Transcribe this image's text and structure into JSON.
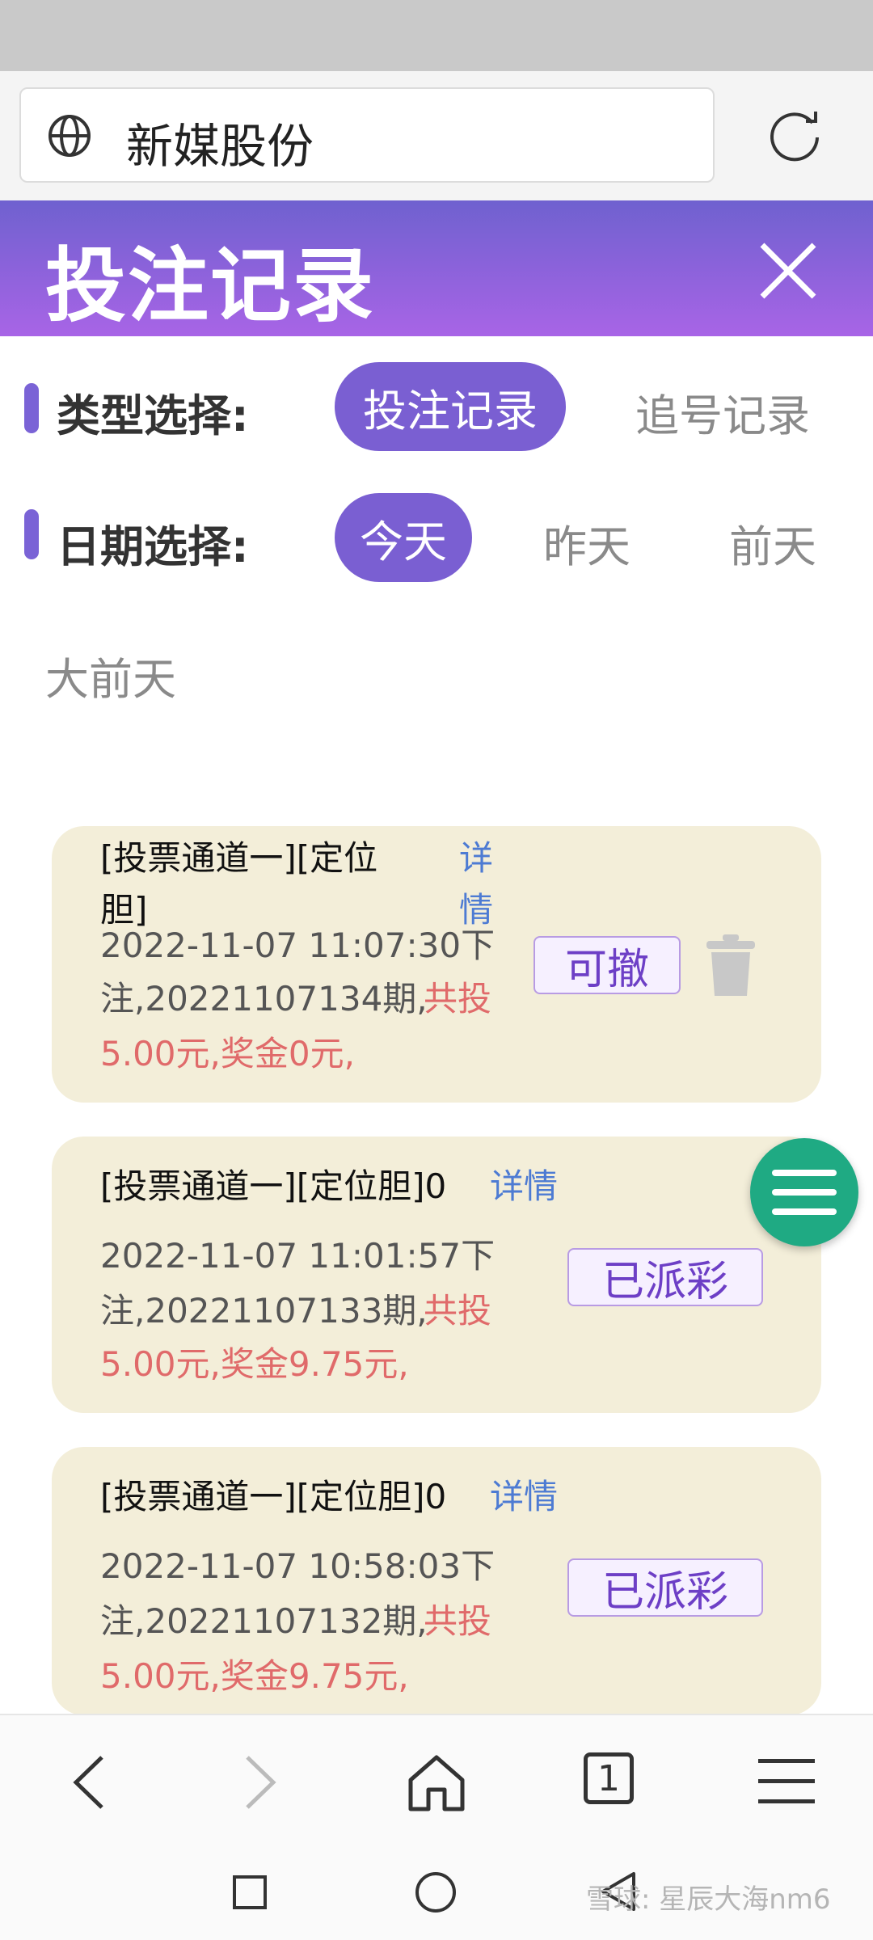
{
  "browser": {
    "url_text": "新媒股份"
  },
  "header": {
    "title": "投注记录"
  },
  "filters": {
    "type_label": "类型选择:",
    "type_options": [
      "投注记录",
      "追号记录"
    ],
    "date_label": "日期选择:",
    "date_options": [
      "今天",
      "昨天",
      "前天",
      "大前天"
    ]
  },
  "records": [
    {
      "title": "[投票通道一][定位胆]",
      "detail": "详情",
      "line1": "2022-11-07 11:07:30下",
      "line2a": "注,20221107134期,",
      "line2b": " 共投",
      "line3": "5.00元,奖金0元,",
      "status": "可撤"
    },
    {
      "title": "[投票通道一][定位胆]0",
      "detail": "详情",
      "line1": "2022-11-07 11:01:57下",
      "line2a": "注,20221107133期,",
      "line2b": " 共投",
      "line3": "5.00元,奖金9.75元,",
      "status": "已派彩"
    },
    {
      "title": "[投票通道一][定位胆]0",
      "detail": "详情",
      "line1": "2022-11-07 10:58:03下",
      "line2a": "注,20221107132期,",
      "line2b": " 共投",
      "line3": "5.00元,奖金9.75元,",
      "status": "已派彩"
    }
  ],
  "browser_nav": {
    "tab_count": "1"
  },
  "watermark": "雪球: 星辰大海nm6"
}
